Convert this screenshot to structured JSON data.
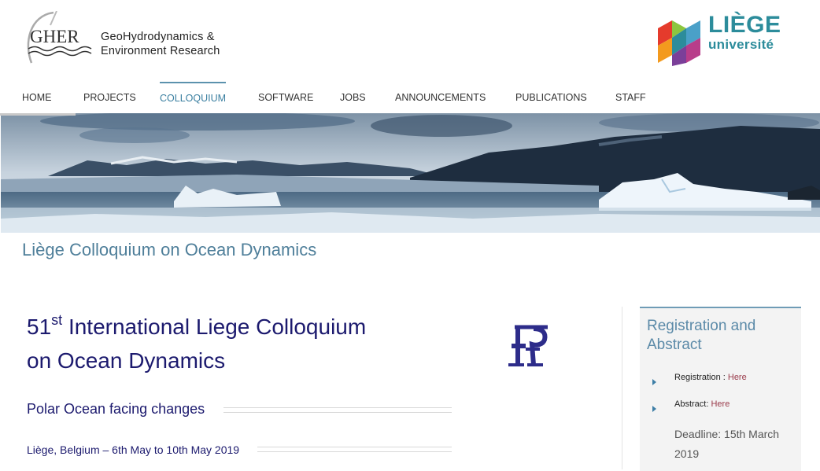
{
  "header": {
    "gher_logo_text": "GHER",
    "gher_line1": "GeoHydrodynamics &",
    "gher_line2": "Environment Research",
    "liege_line1": "LIÈGE",
    "liege_line2": "université"
  },
  "nav": {
    "items": [
      {
        "label": "HOME"
      },
      {
        "label": "PROJECTS"
      },
      {
        "label": "COLLOQUIUM"
      },
      {
        "label": "SOFTWARE"
      },
      {
        "label": "JOBS"
      },
      {
        "label": "ANNOUNCEMENTS"
      },
      {
        "label": "PUBLICATIONS"
      },
      {
        "label": "STAFF"
      }
    ],
    "active": "COLLOQUIUM"
  },
  "page": {
    "title": "Liège Colloquium on Ocean Dynamics"
  },
  "main": {
    "title_num": "51",
    "title_sup": "st",
    "title_line1_rest": " International Liege Colloquium",
    "title_line2": "on Ocean Dynamics",
    "subtitle": "Polar Ocean facing changes",
    "dates": "Liège, Belgium – 6th May to 10th May 2019"
  },
  "sidebar": {
    "title_line1": "Registration and",
    "title_line2": "Abstract",
    "registration_label": "Registration :",
    "registration_link": "Here",
    "abstract_label": "Abstract:",
    "abstract_link": "Here",
    "deadline": "Deadline: 15th March 2019"
  },
  "colors": {
    "accent": "#5b92ad",
    "title_navy": "#1c1a6e",
    "liege_teal": "#2c8c9b",
    "link": "#9a3b4b"
  }
}
